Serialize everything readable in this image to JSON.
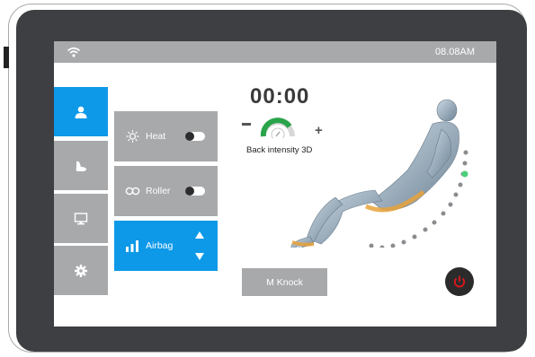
{
  "status_bar": {
    "time": "08.08AM",
    "wifi_icon": "wifi-icon"
  },
  "nav": [
    {
      "name": "user",
      "icon": "user-icon",
      "active": true
    },
    {
      "name": "massage-mode",
      "icon": "foot-icon",
      "active": false
    },
    {
      "name": "display",
      "icon": "monitor-icon",
      "active": false
    },
    {
      "name": "settings",
      "icon": "gear-icon",
      "active": false
    }
  ],
  "controls": {
    "heat": {
      "label": "Heat",
      "icon": "sun-icon",
      "on": false
    },
    "roller": {
      "label": "Roller",
      "icon": "roller-icon",
      "on": false
    },
    "airbag": {
      "label": "Airbag",
      "icon": "signal-bars-icon",
      "active": true
    }
  },
  "timer": "00:00",
  "intensity": {
    "label": "Back intensity 3D"
  },
  "mode_button": {
    "label": "M Knock"
  },
  "colors": {
    "accent": "#0d99e8",
    "panel": "#a8a9ab",
    "power": "#e0161d",
    "gauge": "#2aa44a"
  }
}
